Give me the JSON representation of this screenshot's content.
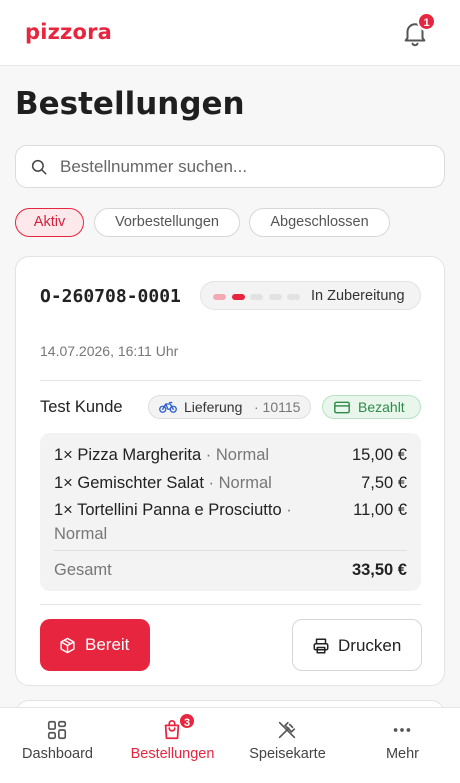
{
  "app": {
    "logo": "pizzora"
  },
  "header": {
    "notifications_count": "1"
  },
  "page": {
    "title": "Bestellungen"
  },
  "search": {
    "placeholder": "Bestellnummer suchen...",
    "value": ""
  },
  "filters": [
    {
      "label": "Aktiv",
      "active": true
    },
    {
      "label": "Vorbestellungen",
      "active": false
    },
    {
      "label": "Abgeschlossen",
      "active": false
    }
  ],
  "order": {
    "id": "O-260708-0001",
    "date": "14.07.2026, 16:11 Uhr",
    "status": {
      "label": "In Zubereitung",
      "steps_total": 5,
      "steps_done": 2,
      "step_colors": {
        "done_light": "#f4aab5",
        "done": "#e8253f",
        "pending": "#e2e2e2"
      }
    },
    "customer": "Test Kunde",
    "delivery": {
      "label": "Lieferung",
      "zip": "· 10115",
      "icon": "bicycle-icon"
    },
    "payment": {
      "label": "Bezahlt",
      "icon": "card-icon"
    },
    "items": [
      {
        "name": "1× Pizza Margherita",
        "variant": " · Normal",
        "price": "15,00 €"
      },
      {
        "name": "1× Gemischter Salat",
        "variant": " · Normal",
        "price": "7,50 €"
      },
      {
        "name": "1× Tortellini Panna e Prosciutto",
        "variant": " · Normal",
        "price": "11,00 €"
      }
    ],
    "total_label": "Gesamt",
    "total_value": "33,50 €",
    "actions": {
      "ready": "Bereit",
      "print": "Drucken"
    }
  },
  "nav": {
    "items": [
      {
        "label": "Dashboard",
        "icon": "dashboard-icon",
        "active": false
      },
      {
        "label": "Bestellungen",
        "icon": "shopping-bag-icon",
        "active": true,
        "badge": "3"
      },
      {
        "label": "Speisekarte",
        "icon": "utensils-icon",
        "active": false
      },
      {
        "label": "Mehr",
        "icon": "more-dots-icon",
        "active": false
      }
    ]
  },
  "colors": {
    "brand": "#e8253f",
    "success": "#2f8a4a",
    "muted": "#777777"
  }
}
